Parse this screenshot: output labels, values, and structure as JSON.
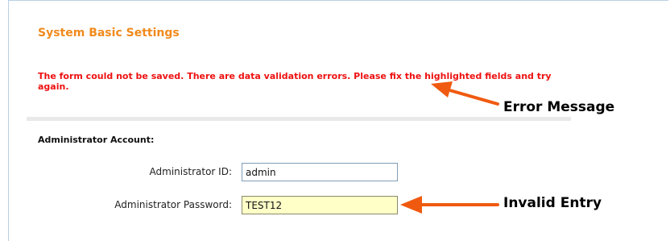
{
  "page": {
    "title": "System Basic Settings",
    "error_message": "The form could not be saved. There are data validation errors. Please fix the highlighted fields and try again."
  },
  "section": {
    "heading": "Administrator Account:"
  },
  "fields": {
    "admin_id": {
      "label": "Administrator ID:",
      "value": "admin"
    },
    "admin_password": {
      "label": "Administrator Password:",
      "value": "TEST12",
      "state": "invalid"
    }
  },
  "annotations": {
    "error_message_label": "Error Message",
    "invalid_entry_label": "Invalid Entry"
  },
  "colors": {
    "title": "#f08a1c",
    "error_text": "#ee1111",
    "invalid_field_bg": "#ffffc8",
    "arrow": "#f05a10"
  }
}
